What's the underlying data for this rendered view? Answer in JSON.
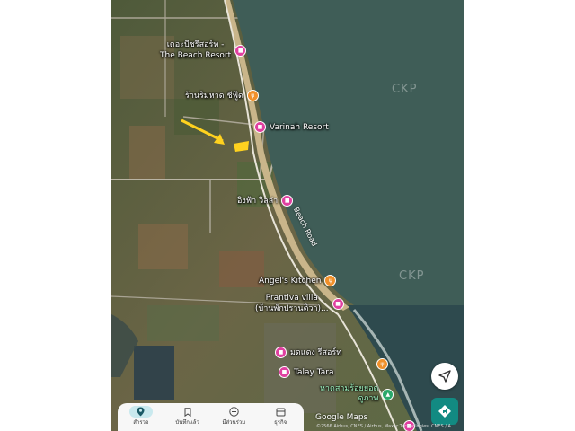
{
  "places": [
    {
      "id": "beach-resort",
      "name": "เดอะบีชรีสอร์ท -",
      "name2": "The Beach Resort",
      "type": "pink",
      "icon": "bed-icon"
    },
    {
      "id": "ran-rim-hat",
      "name": "ร้านริมหาด ชีฟู๊ด",
      "type": "orange",
      "icon": "restaurant-icon"
    },
    {
      "id": "varinah",
      "name": "Varinah Resort",
      "type": "pink",
      "icon": "bed-icon"
    },
    {
      "id": "ing-fah",
      "name": "อิงฟ้า วิลล่า",
      "type": "pink",
      "icon": "bed-icon"
    },
    {
      "id": "angels-kitchen",
      "name": "Angel's Kitchen",
      "type": "orange",
      "icon": "restaurant-icon"
    },
    {
      "id": "prantiva",
      "name": "Prantiva villa",
      "name2": "(บ้านพักปรานติวา)...",
      "type": "pink",
      "icon": "bed-icon"
    },
    {
      "id": "mod-daeng",
      "name": "มดแดง รีสอร์ท",
      "type": "pink",
      "icon": "bed-icon"
    },
    {
      "id": "talay-tara",
      "name": "Talay Tara",
      "type": "pink",
      "icon": "bed-icon"
    },
    {
      "id": "hat-sam-roi",
      "name": "หาดสามร้อยยอด",
      "name2": "ดูภาพ",
      "type": "green",
      "icon": "park-icon"
    }
  ],
  "road": "Beach Road",
  "watermark": "CKP",
  "google_logo": "Google Maps",
  "copyright": "©2566 Airbus, CNES / Airbus, Maxar Technologies, CNES / A",
  "nav": [
    {
      "label": "สำรวจ",
      "icon": "explore-icon",
      "active": true
    },
    {
      "label": "บันทึกแล้ว",
      "icon": "bookmark-icon",
      "active": false
    },
    {
      "label": "มีส่วนร่วม",
      "icon": "add-circle-icon",
      "active": false
    },
    {
      "label": "ธุรกิจ",
      "icon": "store-icon",
      "active": false
    }
  ],
  "colors": {
    "sea": "#3f5d57",
    "land": "#5d6a45",
    "beach": "#c9b58a",
    "pink": "#e040a0",
    "orange": "#f0902a",
    "accent": "#128a82",
    "highlight": "#ffd21f"
  }
}
